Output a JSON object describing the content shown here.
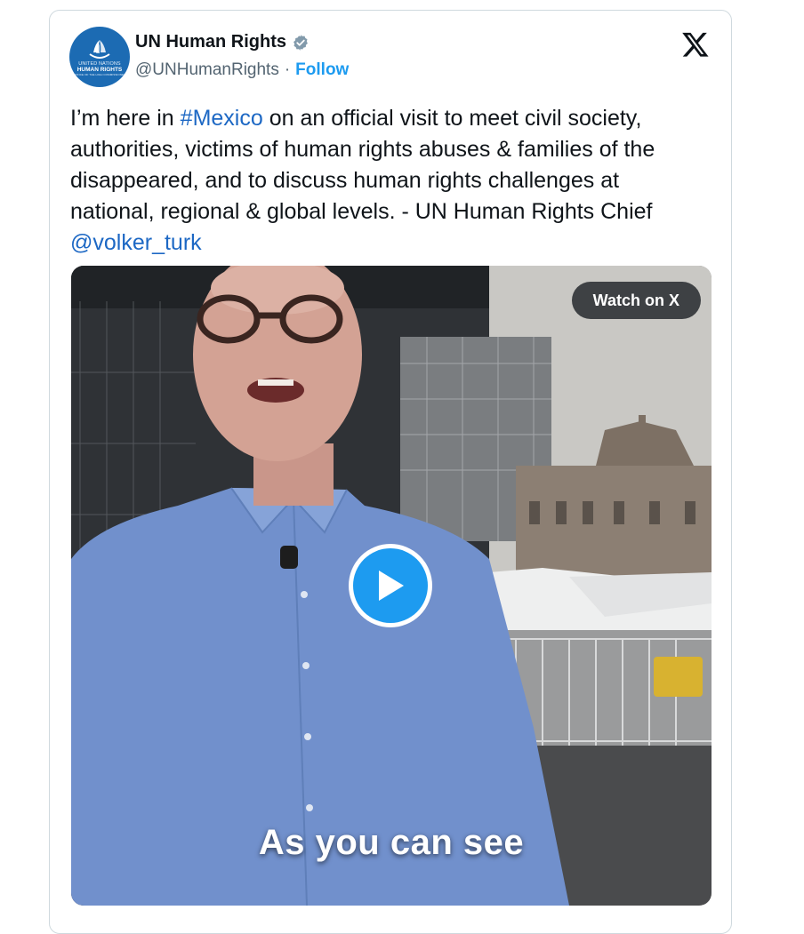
{
  "account": {
    "display_name": "UN Human Rights",
    "handle": "@UNHumanRights",
    "separator": "·",
    "follow_label": "Follow",
    "avatar_text_small": "UNITED NATIONS",
    "avatar_text_big": "HUMAN RIGHTS",
    "avatar_text_tiny": "OFFICE OF THE HIGH COMMISSIONER",
    "verified": true
  },
  "tweet": {
    "text_part1": "I’m here in ",
    "hashtag": "#Mexico",
    "text_part2": " on an official visit to meet civil society, authorities, victims of human rights abuses & families of the disappeared, and to discuss human rights challenges at national, regional & global levels. - UN Human Rights Chief ",
    "mention": "@volker_turk"
  },
  "media": {
    "watch_label": "Watch on X",
    "caption": "As you can see"
  },
  "icons": {
    "platform_logo": "x-logo-icon",
    "verified": "verified-badge-icon",
    "play": "play-icon"
  },
  "colors": {
    "link": "#1d68c4",
    "follow": "#1d9bf0",
    "avatar_bg": "#1c6bb3",
    "play_bg": "#1d9bf0"
  }
}
